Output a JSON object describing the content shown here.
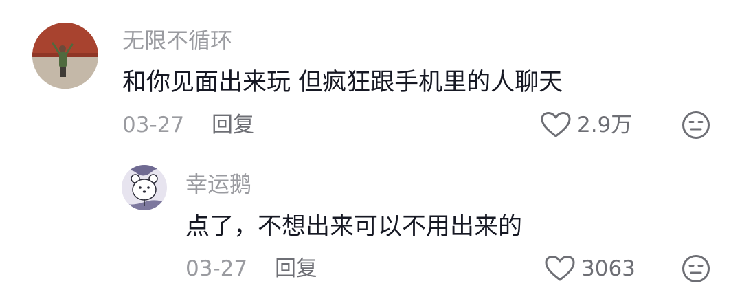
{
  "comments": [
    {
      "username": "无限不循环",
      "content": "和你见面出来玩 但疯狂跟手机里的人聊天",
      "date": "03-27",
      "reply_label": "回复",
      "likes": "2.9万",
      "avatar_icon": "person-raising-arms-avatar"
    },
    {
      "username": "幸运鹅",
      "content": "点了，不想出来可以不用出来的",
      "date": "03-27",
      "reply_label": "回复",
      "likes": "3063",
      "avatar_icon": "white-bear-avatar"
    }
  ],
  "icons": {
    "like": "heart-outline-icon",
    "dislike": "neutral-face-icon"
  }
}
